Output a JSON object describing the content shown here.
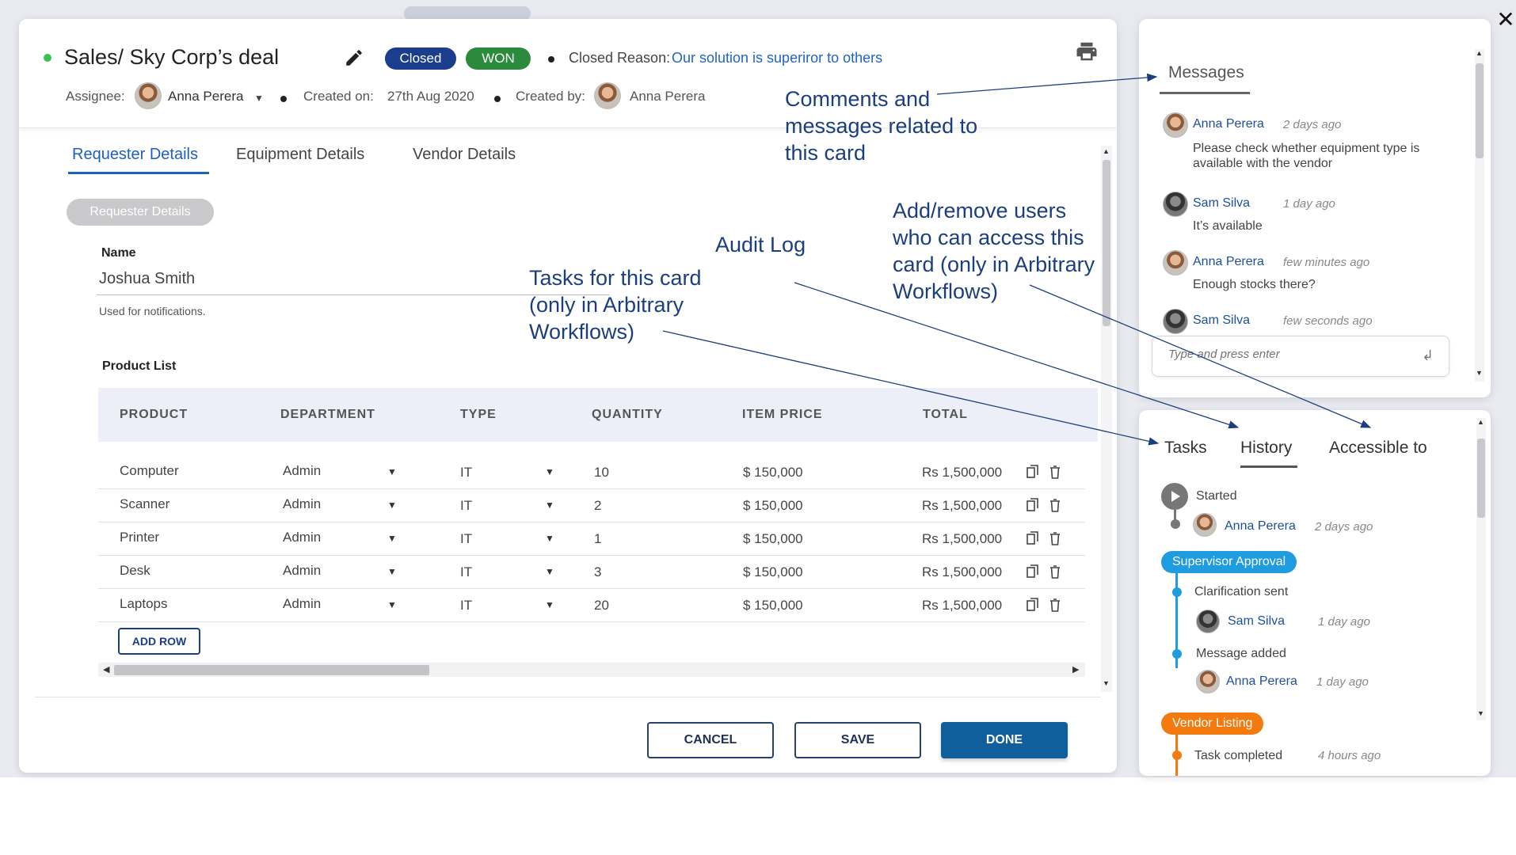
{
  "deal": {
    "title": "Sales/ Sky Corp’s deal",
    "status_badge": "Closed",
    "outcome_badge": "WON",
    "closed_reason_label": "Closed Reason:",
    "closed_reason_value": "Our solution is superiror to others",
    "assignee_label": "Assignee:",
    "assignee_name": "Anna Perera",
    "created_on_label": "Created on:",
    "created_on_value": "27th Aug 2020",
    "created_by_label": "Created by:",
    "created_by_name": "Anna Perera"
  },
  "tabs": [
    "Requester Details",
    "Equipment Details",
    "Vendor Details"
  ],
  "requester": {
    "section_label": "Requester Details",
    "name_label": "Name",
    "name_value": "Joshua Smith",
    "name_help": "Used for notifications.",
    "product_list_label": "Product List"
  },
  "table": {
    "headers": [
      "PRODUCT",
      "DEPARTMENT",
      "TYPE",
      "QUANTITY",
      "ITEM PRICE",
      "TOTAL"
    ],
    "rows": [
      {
        "product": "Computer",
        "department": "Admin",
        "type": "IT",
        "quantity": "10",
        "item_price": "$ 150,000",
        "total": "Rs 1,500,000"
      },
      {
        "product": "Scanner",
        "department": "Admin",
        "type": "IT",
        "quantity": "2",
        "item_price": "$ 150,000",
        "total": "Rs 1,500,000"
      },
      {
        "product": "Printer",
        "department": "Admin",
        "type": "IT",
        "quantity": "1",
        "item_price": "$ 150,000",
        "total": "Rs 1,500,000"
      },
      {
        "product": "Desk",
        "department": "Admin",
        "type": "IT",
        "quantity": "3",
        "item_price": "$ 150,000",
        "total": "Rs 1,500,000"
      },
      {
        "product": "Laptops",
        "department": "Admin",
        "type": "IT",
        "quantity": "20",
        "item_price": "$ 150,000",
        "total": "Rs 1,500,000"
      }
    ],
    "add_row_label": "ADD ROW"
  },
  "footer": {
    "cancel_label": "CANCEL",
    "save_label": "SAVE",
    "done_label": "DONE"
  },
  "annotations": {
    "comments": [
      "Comments and",
      "messages related to",
      "this card"
    ],
    "audit_log": "Audit Log",
    "tasks": [
      "Tasks for this card",
      "(only in Arbitrary",
      "Workflows)"
    ],
    "access": [
      "Add/remove users",
      "who can access this",
      "card (only in Arbitrary",
      "Workflows)"
    ]
  },
  "messages": {
    "title": "Messages",
    "items": [
      {
        "author": "Anna Perera",
        "time": "2 days ago",
        "text": "Please check whether equipment type is available with the vendor"
      },
      {
        "author": "Sam Silva",
        "time": "1 day ago",
        "text": "It’s available"
      },
      {
        "author": "Anna Perera",
        "time": "few minutes ago",
        "text": "Enough stocks there?"
      },
      {
        "author": "Sam Silva",
        "time": "few seconds ago",
        "text": ""
      }
    ],
    "input_placeholder": "Type and press enter"
  },
  "history": {
    "tabs": [
      "Tasks",
      "History",
      "Accessible to"
    ],
    "started_label": "Started",
    "started_by": "Anna Perera",
    "started_time": "2 days ago",
    "stage1_label": "Supervisor Approval",
    "stage1_items": [
      {
        "event": "Clarification sent",
        "user": "Sam Silva",
        "time": "1 day ago"
      },
      {
        "event": "Message added",
        "user": "Anna Perera",
        "time": "1 day ago"
      }
    ],
    "stage2_label": "Vendor Listing",
    "stage2_event": "Task completed",
    "stage2_time": "4 hours ago"
  },
  "colors": {
    "accent": "#1e5fbf",
    "closed_badge": "#1a3e8c",
    "won_badge": "#2c8a3c",
    "done_button": "#0f5f9c",
    "stage_blue": "#1f9be0",
    "stage_orange": "#f27a0f",
    "status_dot": "#39c34e"
  }
}
